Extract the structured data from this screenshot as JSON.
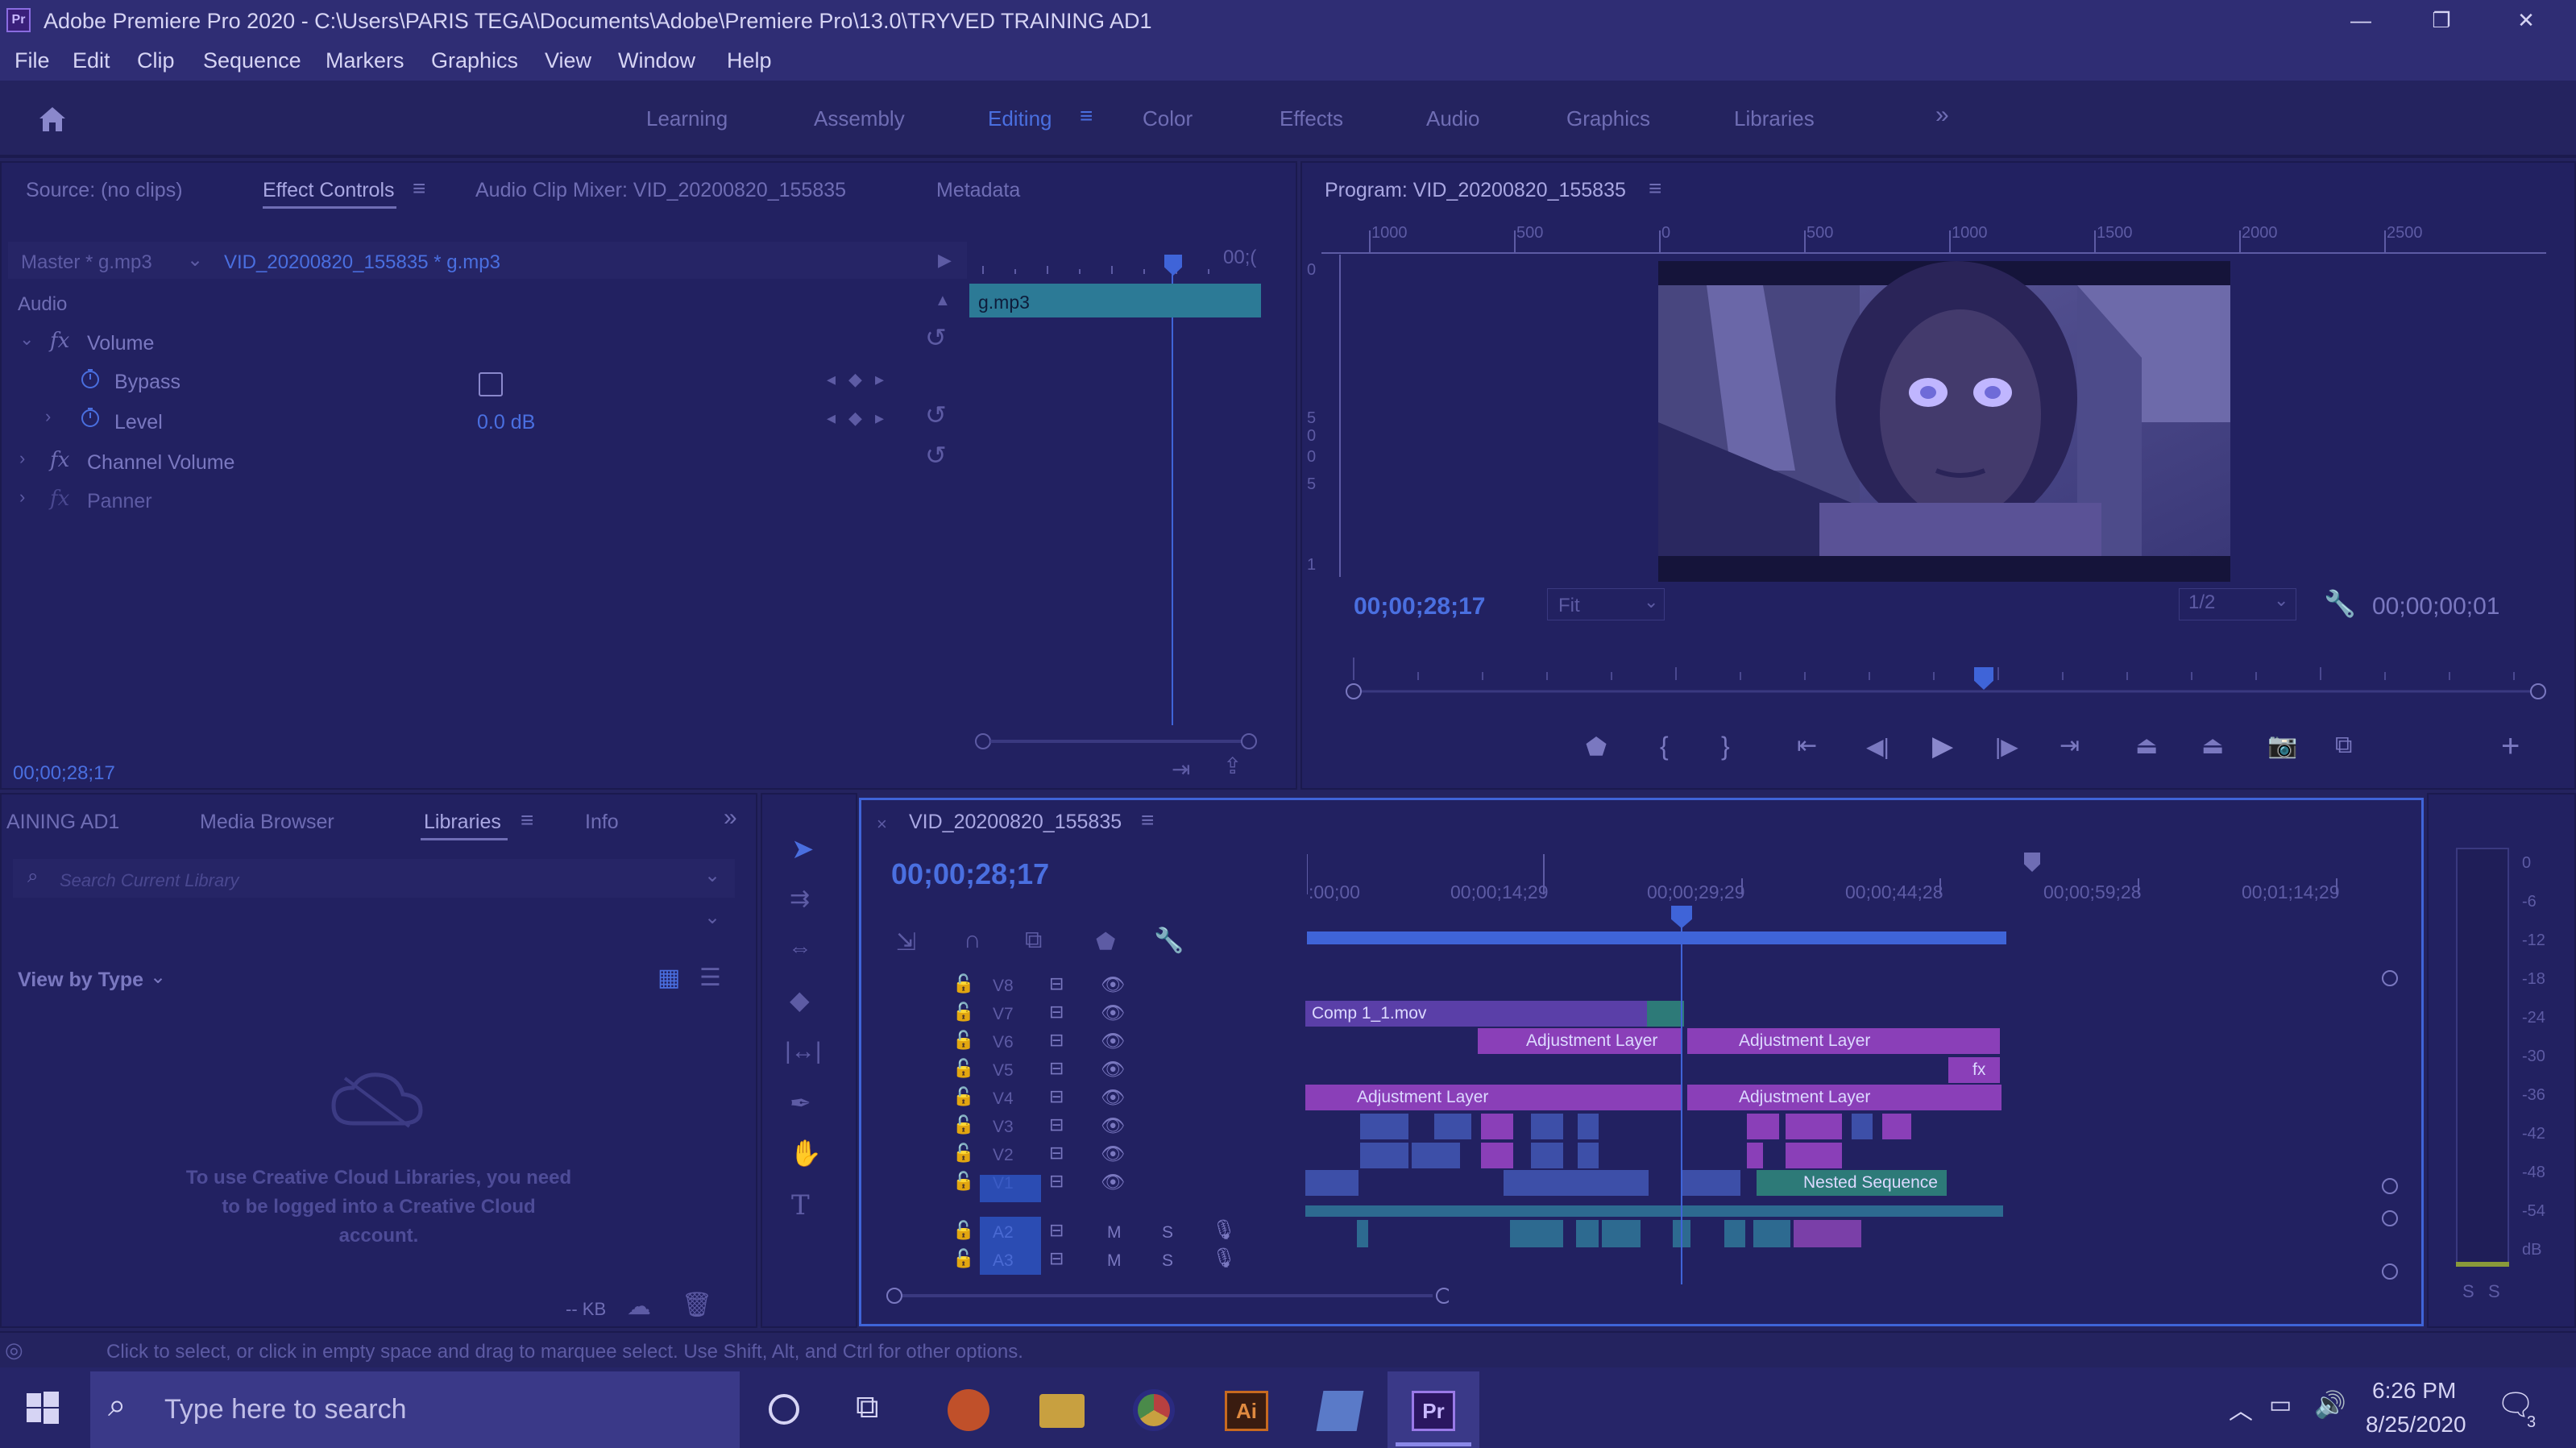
{
  "window": {
    "app_icon": "Pr",
    "title": "Adobe Premiere Pro 2020 - C:\\Users\\PARIS TEGA\\Documents\\Adobe\\Premiere Pro\\13.0\\TRYVED TRAINING AD1",
    "minimize": "—",
    "restore": "❐",
    "close": "✕"
  },
  "menu": [
    "File",
    "Edit",
    "Clip",
    "Sequence",
    "Markers",
    "Graphics",
    "View",
    "Window",
    "Help"
  ],
  "workspaces": {
    "items": [
      "Learning",
      "Assembly",
      "Editing",
      "Color",
      "Effects",
      "Audio",
      "Graphics",
      "Libraries"
    ],
    "active": "Editing",
    "more": "»"
  },
  "source_panel": {
    "tabs": [
      "Source: (no clips)",
      "Effect Controls",
      "Audio Clip Mixer: VID_20200820_155835",
      "Metadata"
    ],
    "active_tab": "Effect Controls",
    "master_label": "Master * g.mp3",
    "clip_label": "VID_20200820_155835 * g.mp3",
    "timeline_tc": "00;(",
    "clip_bar_label": "g.mp3",
    "section_audio": "Audio",
    "effects": [
      {
        "name": "Volume",
        "fx": "fx"
      },
      {
        "name": "Bypass"
      },
      {
        "name": "Level",
        "value": "0.0 dB"
      },
      {
        "name": "Channel Volume",
        "fx": "fx"
      },
      {
        "name": "Panner",
        "fx": "fx"
      }
    ],
    "timecode": "00;00;28;17"
  },
  "program_panel": {
    "title": "Program: VID_20200820_155835",
    "ruler_labels": [
      "1000",
      "500",
      "0",
      "500",
      "1000",
      "1500",
      "2000",
      "2500"
    ],
    "vruler_labels": [
      "0",
      "5",
      "0",
      "0",
      "5",
      "1"
    ],
    "timecode": "00;00;28;17",
    "fit": "Fit",
    "resolution": "1/2",
    "duration": "00;00;00;01"
  },
  "library_panel": {
    "tabs": [
      "AINING AD1",
      "Media Browser",
      "Libraries",
      "Info"
    ],
    "active_tab": "Libraries",
    "search_placeholder": "Search Current Library",
    "view_by": "View by Type",
    "message": "To use Creative Cloud Libraries, you need to be logged into a Creative Cloud account.",
    "kb": "-- KB"
  },
  "timeline": {
    "sequence_name": "VID_20200820_155835",
    "timecode": "00;00;28;17",
    "ruler_labels": [
      ":00;00",
      "00;00;14;29",
      "00;00;29;29",
      "00;00;44;28",
      "00;00;59;28",
      "00;01;14;29"
    ],
    "video_tracks": [
      "V8",
      "V7",
      "V6",
      "V5",
      "V4",
      "V3",
      "V2",
      "V1"
    ],
    "audio_tracks": [
      "A2",
      "A3"
    ],
    "mute": "M",
    "solo": "S",
    "clips": {
      "comp": "Comp 1_1.mov",
      "adj1": "Adjustment Layer",
      "adj2": "Adjustment Layer",
      "adj3": "Adjustment Layer",
      "adj4": "Adjustment Layer",
      "nested": "Nested Sequence",
      "fx": "fx"
    }
  },
  "meter": {
    "labels": [
      "0",
      "-6",
      "-12",
      "-18",
      "-24",
      "-30",
      "-36",
      "-42",
      "-48",
      "-54",
      "dB"
    ],
    "solo_left": "S",
    "solo_right": "S"
  },
  "status": {
    "message": "Click to select, or click in empty space and drag to marquee select. Use Shift, Alt, and Ctrl for other options."
  },
  "taskbar": {
    "search_placeholder": "Type here to search",
    "time": "6:26 PM",
    "date": "8/25/2020",
    "notif_count": "3"
  },
  "colors": {
    "background": "#24235f",
    "accent": "#4a6fe0",
    "clip_purple": "#8a3fb8",
    "clip_blue": "#3d4fa8",
    "clip_green": "#2d7a78"
  }
}
